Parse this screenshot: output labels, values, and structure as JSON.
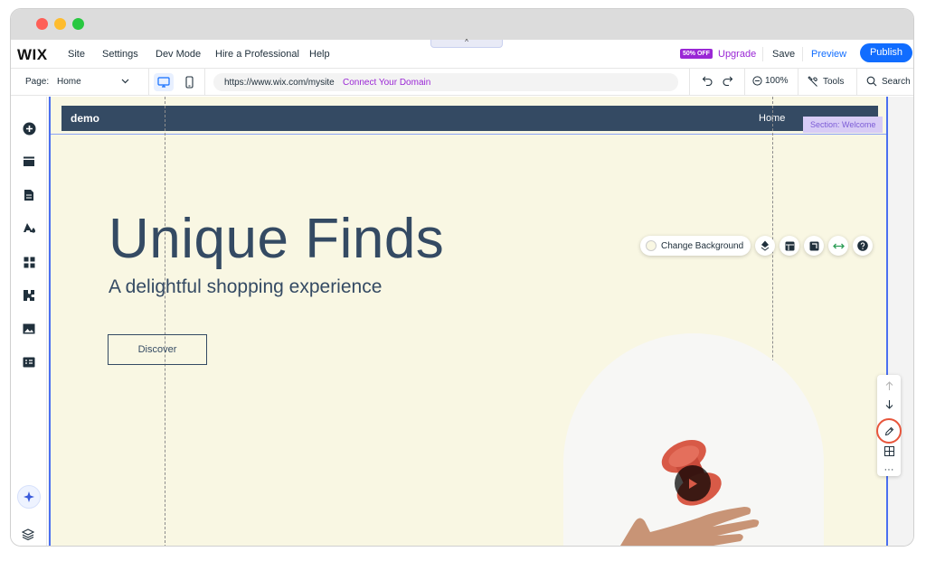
{
  "app": {
    "logo": "WIX",
    "menu": [
      "Site",
      "Settings",
      "Dev Mode",
      "Hire a Professional",
      "Help"
    ],
    "collapse_icon": "^",
    "promo_badge": "50% OFF",
    "upgrade": "Upgrade",
    "save": "Save",
    "preview": "Preview",
    "publish": "Publish"
  },
  "toolbar": {
    "page_label": "Page:",
    "page_value": "Home",
    "url": "https://www.wix.com/mysite",
    "connect_domain": "Connect Your Domain",
    "zoom": "100%",
    "tools": "Tools",
    "search": "Search"
  },
  "sidebar": {
    "icons": [
      "add-icon",
      "sections-icon",
      "pages-icon",
      "design-icon",
      "apps-icon",
      "business-apps-icon",
      "media-icon",
      "cms-icon"
    ],
    "ai_icon": "sparkle-icon",
    "layers_icon": "layers-icon"
  },
  "site": {
    "logo": "demo",
    "nav_home": "Home",
    "section_tag": "Section: Welcome",
    "hero_title": "Unique Finds",
    "hero_subtitle": "A delightful shopping experience",
    "cta": "Discover"
  },
  "context_toolbar": {
    "change_background": "Change Background"
  },
  "side_panel": {
    "more": "···"
  },
  "colors": {
    "accent": "#116dff",
    "premium": "#9a27d5",
    "site_bg": "#f9f7e3",
    "site_header": "#344a63",
    "selection": "#4b6ff0",
    "highlight_ring": "#e7553b",
    "toy": "#d85a47"
  }
}
